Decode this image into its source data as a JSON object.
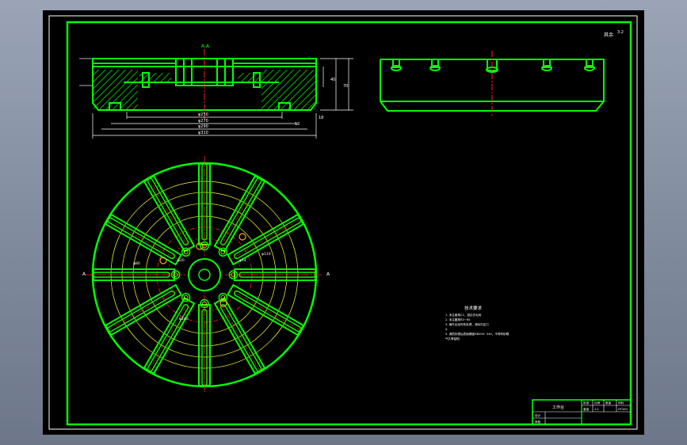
{
  "app": {
    "background_color": "#848ea0",
    "viewport_color": "#000000",
    "accent_green": "#00ff00",
    "red": "#ff2020",
    "yellow": "#ffff33",
    "white": "#ffffff"
  },
  "drawing": {
    "dims_top": {
      "d1": "φ250",
      "d2": "φ270",
      "d3": "φ290",
      "d4": "φ310",
      "h1": "40",
      "h2": "70",
      "h3": "18",
      "h4": "12"
    },
    "center_dims": {
      "b1": "φ20",
      "b2": "φ14",
      "b3": "φ80",
      "b4": "φ110",
      "b5": "φ140"
    },
    "title_block": {
      "name": "工作台",
      "c1": "批准",
      "c2": "比例",
      "c3": "数量",
      "c4": "材料",
      "c5": "重量",
      "c6": "设计",
      "c7": "审核",
      "c8": "1:1",
      "c9": "HT200"
    },
    "notes": {
      "heading": "技术要求",
      "line1": "1. 未注倒角C1，锐边去毛刺",
      "line2": "2. 未注圆角R3~R5",
      "line3": "3. 铸件应经时效处理，消除内应力",
      "line4": "4.",
      "line5": "5. 调质处理后表面硬度HB200~240，不得有砂眼",
      "line6": "气孔等缺陷"
    },
    "roughness_label": "其余",
    "roughness_value": "3.2",
    "section_mark": "A"
  }
}
